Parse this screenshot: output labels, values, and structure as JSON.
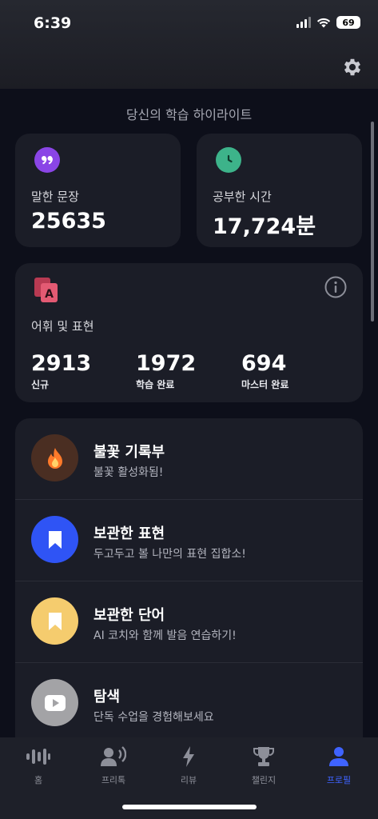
{
  "status": {
    "time": "6:39",
    "battery": "69"
  },
  "highlights_title": "당신의 학습 하이라이트",
  "stats": {
    "sentences": {
      "label": "말한 문장",
      "value": "25635"
    },
    "time": {
      "label": "공부한 시간",
      "value": "17,724분"
    }
  },
  "vocab": {
    "title": "어휘 및 표현",
    "items": [
      {
        "value": "2913",
        "label": "신규"
      },
      {
        "value": "1972",
        "label": "학습 완료"
      },
      {
        "value": "694",
        "label": "마스터 완료"
      }
    ]
  },
  "menu": [
    {
      "title": "불꽃 기록부",
      "subtitle": "불꽃 활성화됨!",
      "icon": "flame-icon"
    },
    {
      "title": "보관한 표현",
      "subtitle": "두고두고 볼 나만의 표현 집합소!",
      "icon": "bookmark-icon"
    },
    {
      "title": "보관한 단어",
      "subtitle": "AI 코치와 함께 발음 연습하기!",
      "icon": "bookmark-icon"
    },
    {
      "title": "탐색",
      "subtitle": "단독 수업을 경험해보세요",
      "icon": "play-icon"
    }
  ],
  "tabs": [
    {
      "label": "홈",
      "icon": "waveform-icon"
    },
    {
      "label": "프리톡",
      "icon": "speaker-person-icon"
    },
    {
      "label": "리뷰",
      "icon": "lightning-icon"
    },
    {
      "label": "챌린지",
      "icon": "trophy-icon"
    },
    {
      "label": "프로필",
      "icon": "person-icon",
      "active": true
    }
  ],
  "colors": {
    "accent": "#3f63ff",
    "card": "#1b1d27",
    "background": "#0d0f1a"
  }
}
